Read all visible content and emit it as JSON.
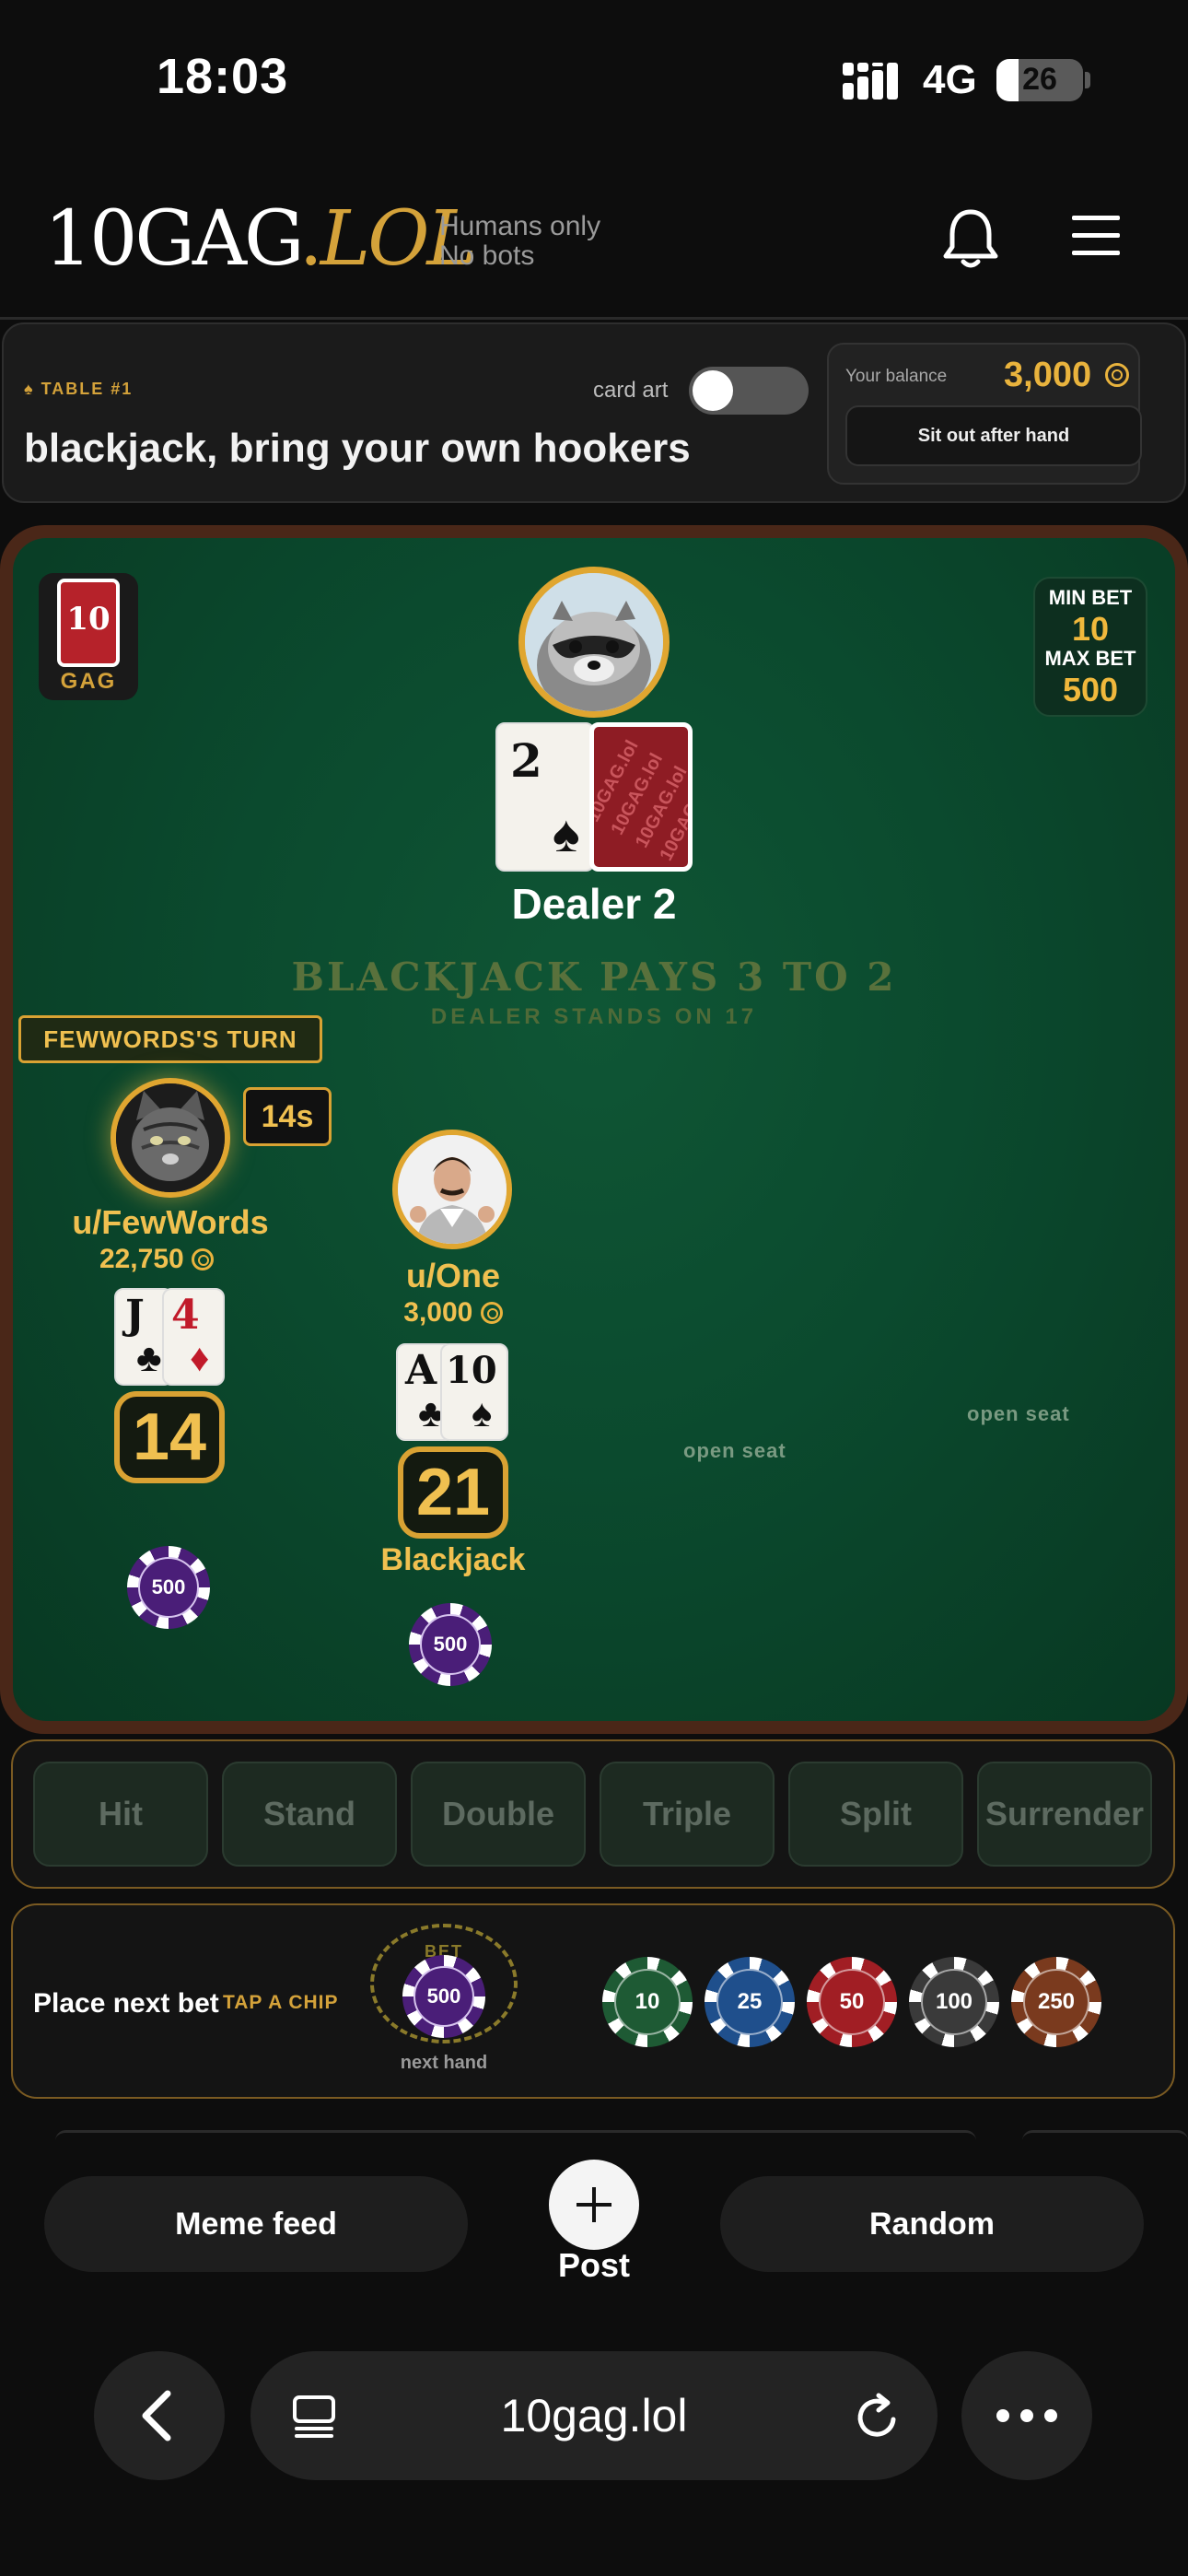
{
  "status_bar": {
    "time": "18:03",
    "network": "4G",
    "battery": "26"
  },
  "header": {
    "logo_main": "10GAG",
    "logo_dot": ".",
    "logo_suffix": "LOL",
    "tagline_1": "Humans only",
    "tagline_2": "No bots"
  },
  "table_info": {
    "tag": "♠ TABLE #1",
    "title": "blackjack, bring your own hookers",
    "card_art_label": "card art",
    "card_art_on": false,
    "balance_label": "Your balance",
    "balance_value": "3,000",
    "sit_out_label": "Sit out after hand"
  },
  "felt": {
    "deck_number": "10",
    "deck_label": "GAG",
    "min_bet_label": "MIN BET",
    "min_bet_value": "10",
    "max_bet_label": "MAX BET",
    "max_bet_value": "500",
    "dealer_card_rank": "2",
    "dealer_card_suit": "♠",
    "card_back_text": "10GAG.lol",
    "dealer_label": "Dealer 2",
    "pays_text": "BLACKJACK PAYS 3 TO 2",
    "stands_text": "DEALER STANDS ON 17",
    "turn_badge": "FEWWORDS'S TURN",
    "timer": "14s",
    "open_seat_label": "open seat"
  },
  "players": [
    {
      "name": "u/FewWords",
      "balance": "22,750",
      "cards": [
        {
          "rank": "J",
          "suit": "♣"
        },
        {
          "rank": "4",
          "suit": "♦"
        }
      ],
      "total": "14",
      "result": "",
      "bet": "500"
    },
    {
      "name": "u/One",
      "balance": "3,000",
      "cards": [
        {
          "rank": "A",
          "suit": "♣"
        },
        {
          "rank": "10",
          "suit": "♠"
        }
      ],
      "total": "21",
      "result": "Blackjack",
      "bet": "500"
    }
  ],
  "actions": [
    "Hit",
    "Stand",
    "Double",
    "Triple",
    "Split",
    "Surrender"
  ],
  "bet_panel": {
    "place_label": "Place next bet",
    "tap_label": "TAP A CHIP",
    "slot_label": "BET",
    "slot_value": "500",
    "next_hand_label": "next hand",
    "chips": [
      {
        "value": "10",
        "color": "#1e5a34"
      },
      {
        "value": "25",
        "color": "#1f4f8c"
      },
      {
        "value": "50",
        "color": "#a11e24"
      },
      {
        "value": "100",
        "color": "#3a3a3a"
      },
      {
        "value": "250",
        "color": "#7a3a1e"
      }
    ]
  },
  "bottom_nav": {
    "meme_feed": "Meme feed",
    "post": "Post",
    "random": "Random"
  },
  "browser": {
    "url": "10gag.lol"
  },
  "colors": {
    "accent": "#d4a23a",
    "felt": "#0b4a2e",
    "rail": "#4a2718",
    "background": "#0d0d0d"
  }
}
